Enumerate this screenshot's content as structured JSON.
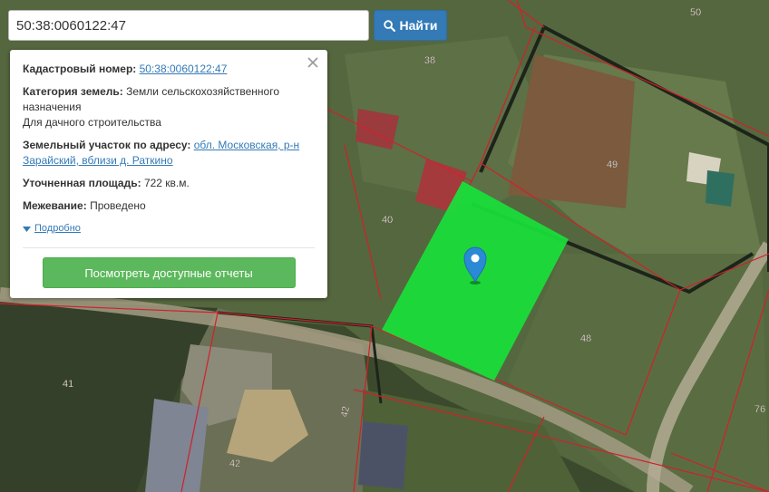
{
  "search": {
    "value": "50:38:0060122:47",
    "button_label": "Найти"
  },
  "info": {
    "cadastral_label": "Кадастровый номер:",
    "cadastral_value": "50:38:0060122:47",
    "category_label": "Категория земель:",
    "category_value": "Земли сельскохозяйственного назначения",
    "category_use": "Для дачного строительства",
    "address_label": "Земельный участок по адресу:",
    "address_value": "обл. Московская, р-н Зарайский, вблизи д. Раткино",
    "area_label": "Уточненная площадь:",
    "area_value": "722 кв.м.",
    "survey_label": "Межевание:",
    "survey_value": "Проведено",
    "more_label": "Подробно",
    "reports_button": "Посмотреть доступные отчеты"
  },
  "map": {
    "parcel_labels": [
      "50",
      "38",
      "49",
      "40",
      "48",
      "41",
      "42",
      "42",
      "76"
    ],
    "highlight_color": "#19e03a",
    "marker_color": "#2a8ad4",
    "boundary_color": "#d2202a"
  }
}
